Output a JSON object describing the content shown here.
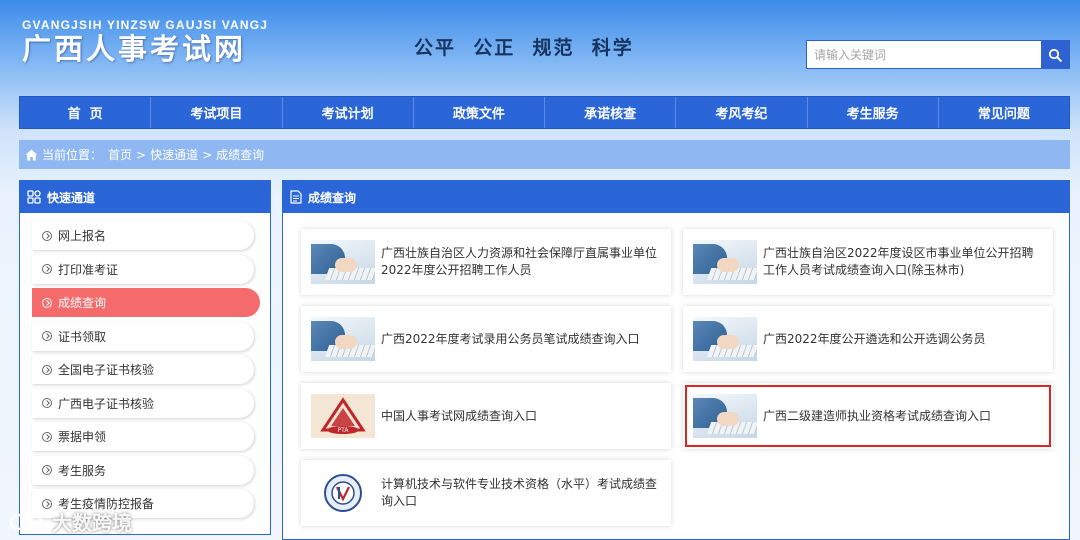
{
  "header": {
    "logo_pinyin": "GVANGJSIH YINZSW GAUJSI VANGJ",
    "logo_name": "广西人事考试网",
    "slogan": "公平  公正  规范  科学",
    "search": {
      "placeholder": "请输入关键词",
      "icon": "search-icon"
    }
  },
  "nav": {
    "items": [
      {
        "label": "首  页"
      },
      {
        "label": "考试项目"
      },
      {
        "label": "考试计划"
      },
      {
        "label": "政策文件"
      },
      {
        "label": "承诺核查"
      },
      {
        "label": "考风考纪"
      },
      {
        "label": "考生服务"
      },
      {
        "label": "常见问题"
      }
    ]
  },
  "breadcrumb": {
    "prefix": "当前位置：",
    "items": [
      "首页",
      "快速通道",
      "成绩查询"
    ],
    "separator": ">",
    "icon": "home-icon"
  },
  "sidebar": {
    "title": "快速通道",
    "icon": "grid-icon",
    "items": [
      {
        "label": "网上报名"
      },
      {
        "label": "打印准考证"
      },
      {
        "label": "成绩查询",
        "active": true
      },
      {
        "label": "证书领取"
      },
      {
        "label": "全国电子证书核验"
      },
      {
        "label": "广西电子证书核验"
      },
      {
        "label": "票据申领"
      },
      {
        "label": "考生服务"
      },
      {
        "label": "考生疫情防控报备"
      }
    ]
  },
  "main": {
    "title": "成绩查询",
    "icon": "document-icon",
    "cards": [
      {
        "text": "广西壮族自治区人力资源和社会保障厅直属事业单位2022年度公开招聘工作人员",
        "thumb": "keyboard-photo"
      },
      {
        "text": "广西壮族自治区2022年度设区市事业单位公开招聘工作人员考试成绩查询入口(除玉林市)",
        "thumb": "keyboard-photo"
      },
      {
        "text": "广西2022年度考试录用公务员笔试成绩查询入口",
        "thumb": "keyboard-photo"
      },
      {
        "text": "广西2022年度公开遴选和公开选调公务员",
        "thumb": "keyboard-photo"
      },
      {
        "text": "中国人事考试网成绩查询入口",
        "thumb": "pta-logo",
        "logo_text": "PTA"
      },
      {
        "text": "广西二级建造师执业资格考试成绩查询入口",
        "thumb": "keyboard-photo",
        "highlighted": true
      },
      {
        "text": "计算机技术与软件专业技术资格（水平）考试成绩查询入口",
        "thumb": "rk-logo"
      }
    ]
  },
  "watermark": {
    "text": "大数跨境"
  },
  "colors": {
    "primary": "#2a66d8",
    "breadcrumb_bg": "#8fb8f2",
    "active_item": "#f56b6b",
    "highlight_border": "#e02424"
  }
}
